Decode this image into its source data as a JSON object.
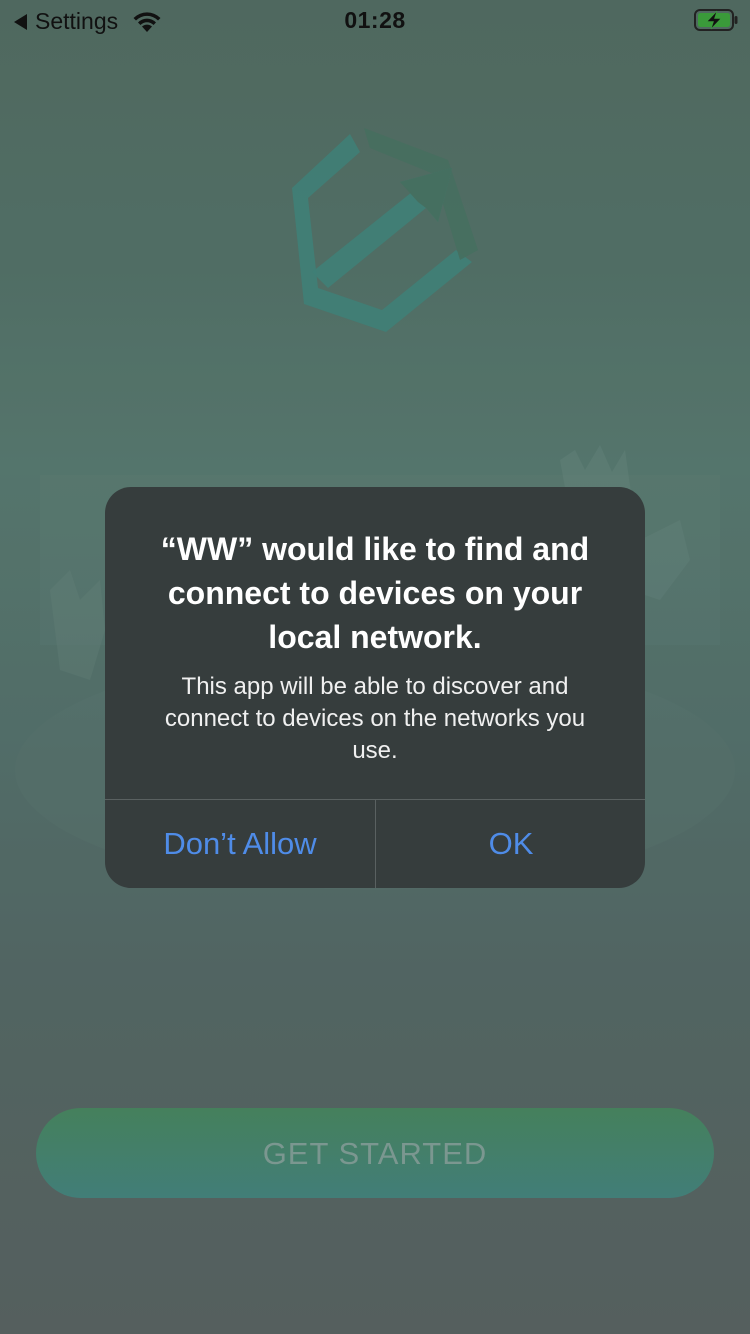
{
  "status_bar": {
    "back_label": "Settings",
    "time": "01:28",
    "icons": [
      "back-arrow-icon",
      "wifi-icon",
      "battery-charging-icon"
    ]
  },
  "app": {
    "logo_icon": "hexagon-arrow-logo-icon",
    "get_started_label": "GET STARTED"
  },
  "alert": {
    "title": "“WW” would like to find and connect to devices on your local network.",
    "message": "This app will be able to discover and connect to devices on the networks you use.",
    "deny_label": "Don’t Allow",
    "ok_label": "OK"
  },
  "colors": {
    "alert_background": "#363d3d",
    "alert_button_text": "#4f8ce8",
    "battery_fill": "#3a9a3a"
  }
}
